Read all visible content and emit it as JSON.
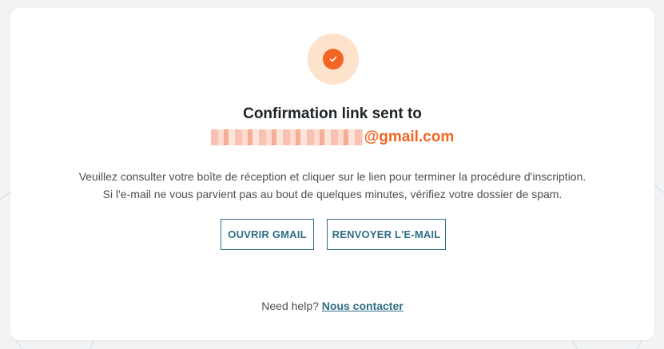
{
  "card": {
    "title": "Confirmation link sent to",
    "email_domain": "@gmail.com",
    "instructions_line1": "Veuillez consulter votre boîte de réception et cliquer sur le lien pour terminer la procédure d'inscription.",
    "instructions_line2": "Si l'e-mail ne vous parvient pas au bout de quelques minutes, vérifiez votre dossier de spam.",
    "open_gmail_label": "OUVRIR GMAIL",
    "resend_label": "RENVOYER L'E-MAIL",
    "help_prefix": "Need help?",
    "help_link": "Nous contacter"
  },
  "icons": {
    "check": "check-icon"
  },
  "colors": {
    "accent": "#f26522",
    "accent_light": "#fde2cc",
    "button_border": "#2e6e85",
    "text": "#1d2327"
  }
}
